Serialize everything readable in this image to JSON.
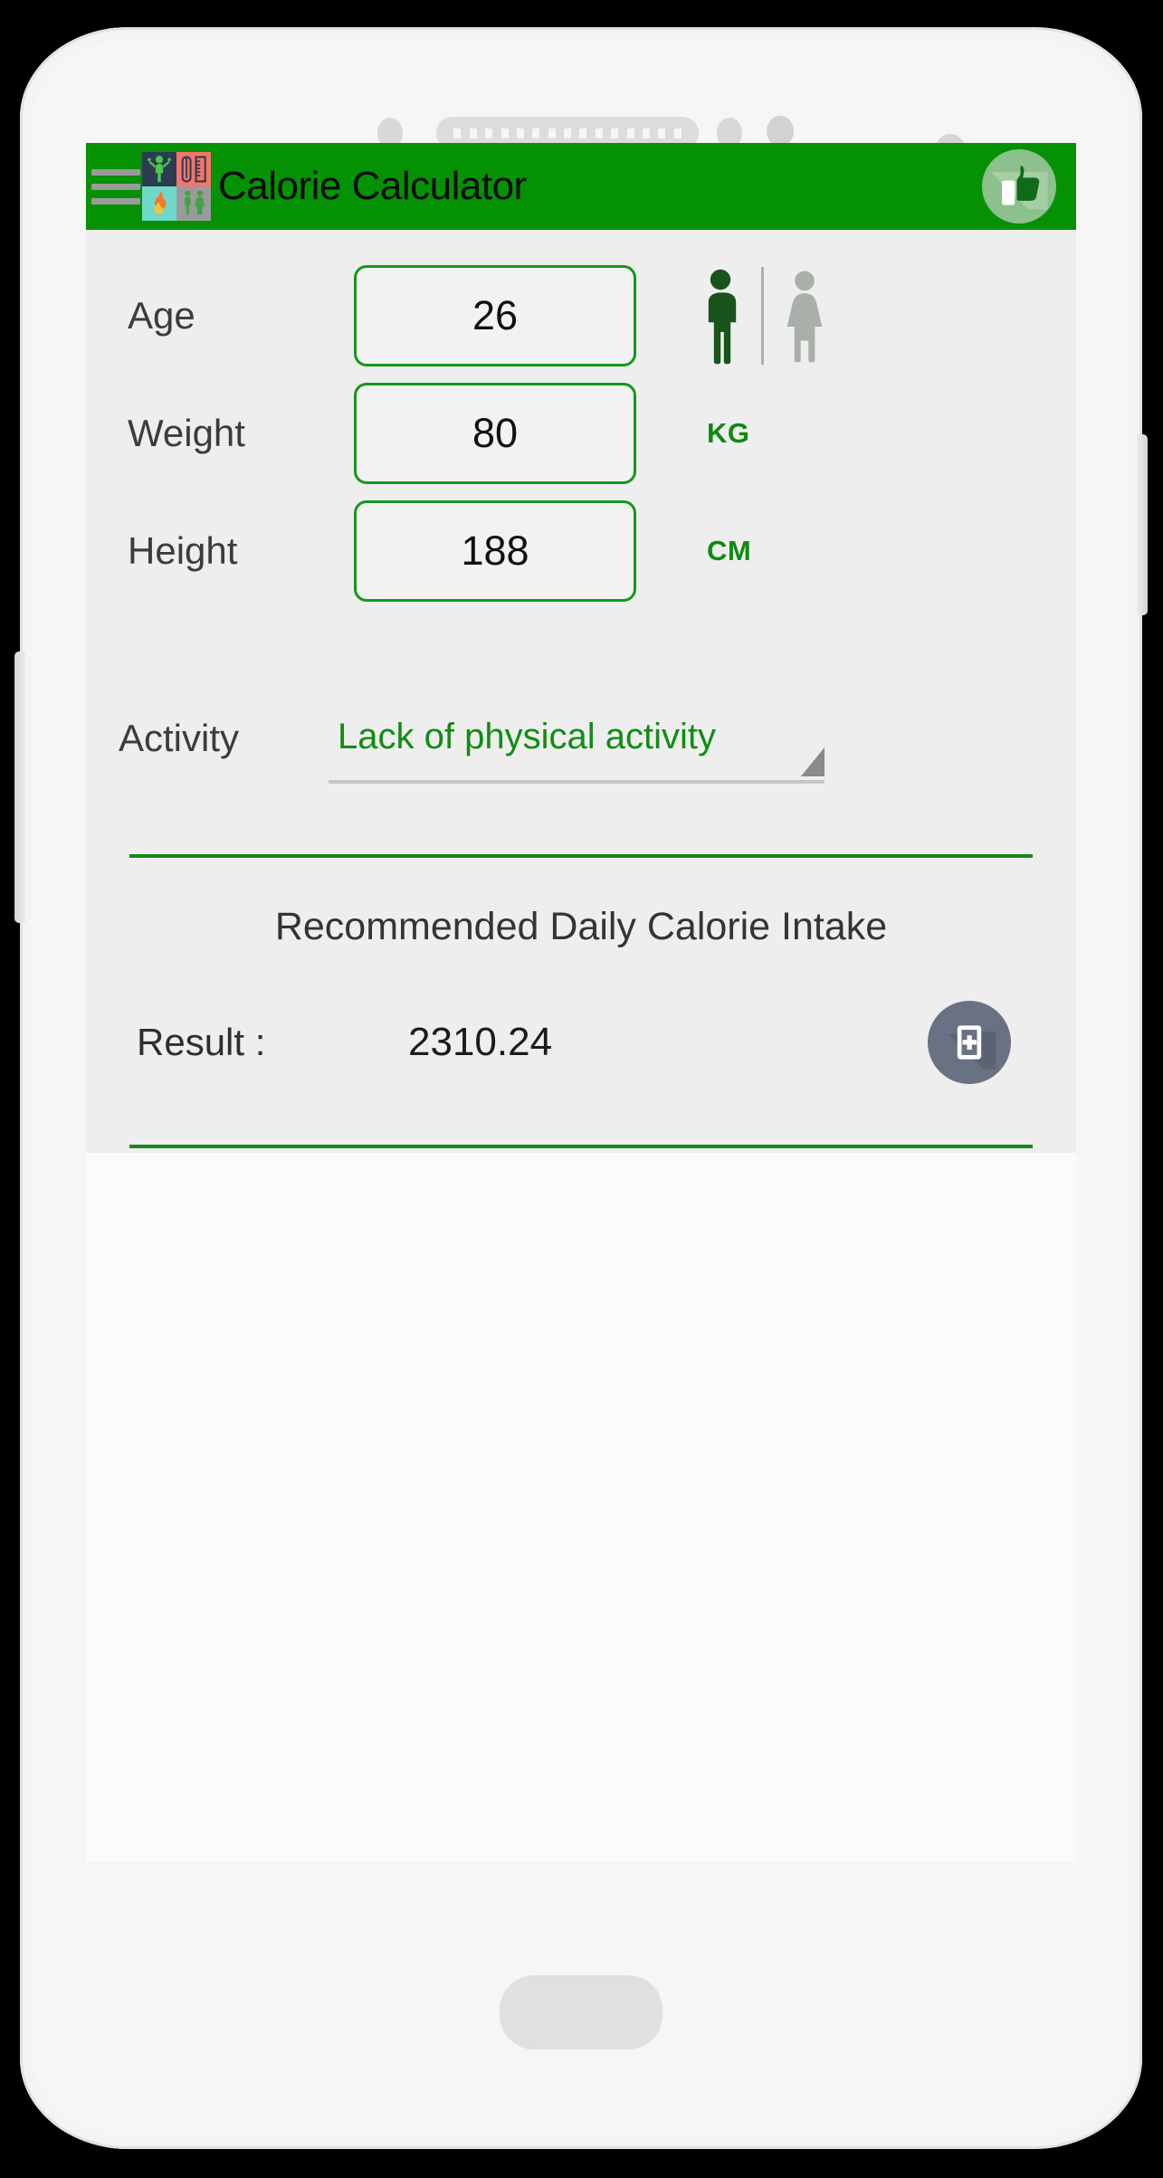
{
  "device": {
    "hardware": {
      "earpiece_speaker": "speaker-grille",
      "proximity_sensor": "sensor-dot",
      "front_camera": "camera-lens",
      "home_button": "home-button",
      "volume_rocker": "volume-rocker",
      "power_button": "power-button"
    }
  },
  "action_bar": {
    "menu_icon": "hamburger-menu-icon",
    "app_icon": "calorie-calculator-app-icon",
    "title": "Calorie Calculator",
    "like_icon": "thumbs-up-icon",
    "bar_color": "#049104",
    "title_color": "#0b0b0b"
  },
  "form": {
    "fields": [
      {
        "label": "Age",
        "value": "26",
        "unit": ""
      },
      {
        "label": "Weight",
        "value": "80",
        "unit": "KG"
      },
      {
        "label": "Height",
        "value": "188",
        "unit": "CM"
      }
    ],
    "input_placeholder": "",
    "border_color": "#16971b",
    "unit_color": "#0f8a12"
  },
  "gender": {
    "male_icon": "male-figure-icon",
    "female_icon": "female-figure-icon",
    "selected": "male",
    "selected_color": "#17551c",
    "unselected_color": "#a9b0a9"
  },
  "activity": {
    "label": "Activity",
    "selected_option": "Lack of physical activity",
    "options": [
      "Lack of physical activity"
    ],
    "caret_icon": "dropdown-caret-icon",
    "value_color": "#128c12"
  },
  "result": {
    "title": "Recommended Daily Calorie Intake",
    "label": "Result :",
    "value": "2310.24",
    "save_icon": "add-to-list-icon",
    "save_button_color": "#697183",
    "divider_color": "#15891a"
  }
}
